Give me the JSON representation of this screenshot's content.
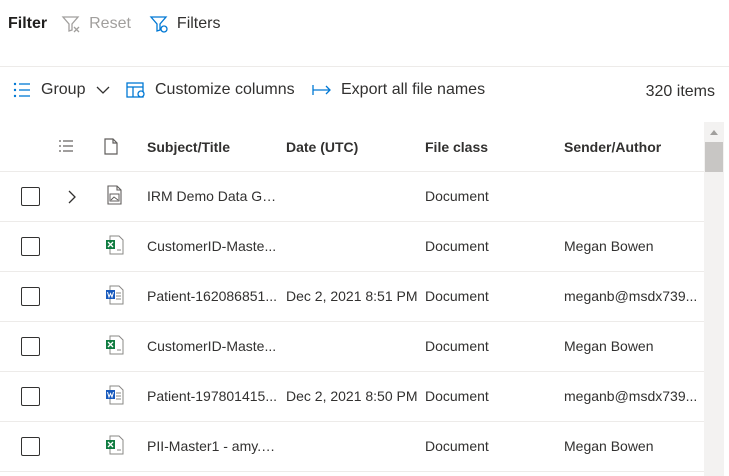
{
  "filter": {
    "title": "Filter",
    "reset_label": "Reset",
    "filters_label": "Filters"
  },
  "commands": {
    "group_label": "Group",
    "customize_label": "Customize columns",
    "export_label": "Export all file names",
    "item_count": "320 items"
  },
  "columns": {
    "subject": "Subject/Title",
    "date": "Date (UTC)",
    "file_class": "File class",
    "sender": "Sender/Author"
  },
  "rows": [
    {
      "file_icon": "image-file-icon",
      "expandable": true,
      "subject": "IRM Demo Data Ge...",
      "date": "",
      "file_class": "Document",
      "sender": ""
    },
    {
      "file_icon": "excel-file-icon",
      "expandable": false,
      "subject": "CustomerID-Maste...",
      "date": "",
      "file_class": "Document",
      "sender": "Megan Bowen"
    },
    {
      "file_icon": "word-file-icon",
      "expandable": false,
      "subject": "Patient-162086851...",
      "date": "Dec 2, 2021 8:51 PM",
      "file_class": "Document",
      "sender": "meganb@msdx739..."
    },
    {
      "file_icon": "excel-file-icon",
      "expandable": false,
      "subject": "CustomerID-Maste...",
      "date": "",
      "file_class": "Document",
      "sender": "Megan Bowen"
    },
    {
      "file_icon": "word-file-icon",
      "expandable": false,
      "subject": "Patient-197801415...",
      "date": "Dec 2, 2021 8:50 PM",
      "file_class": "Document",
      "sender": "meganb@msdx739..."
    },
    {
      "file_icon": "excel-file-icon",
      "expandable": false,
      "subject": "PII-Master1 - amy.c...",
      "date": "",
      "file_class": "Document",
      "sender": "Megan Bowen"
    }
  ],
  "colors": {
    "accent": "#0078d4",
    "excel": "#107c41",
    "word": "#185abd",
    "border": "#edebe9",
    "disabled": "#a19f9d"
  }
}
